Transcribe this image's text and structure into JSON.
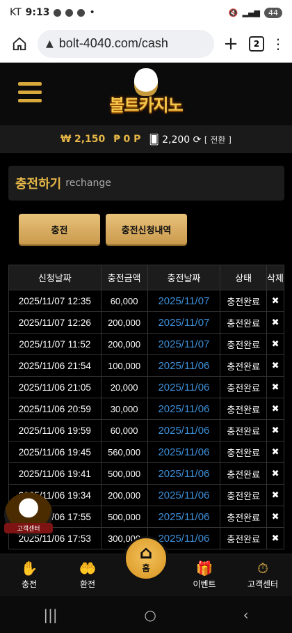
{
  "status_bar": {
    "carrier": "KT",
    "time": "9:13",
    "dot": "•",
    "battery": "44"
  },
  "browser": {
    "url": "bolt-4040.com/cash",
    "tab_count": "2"
  },
  "header": {
    "logo_text": "볼트카지노"
  },
  "balance": {
    "won_symbol": "₩",
    "won_value": "2,150",
    "point_symbol": "₱",
    "point_value": "0 P",
    "chip_value": "2,200",
    "convert_label": "[ 전환 ]"
  },
  "page": {
    "title_ko": "충전하기",
    "title_en": "rechange"
  },
  "buttons": {
    "charge": "충전",
    "history": "충전신청내역"
  },
  "table": {
    "headers": [
      "신청날짜",
      "충전금액",
      "충전날짜",
      "상태",
      "삭제"
    ],
    "rows": [
      {
        "req": "2025/11/07 12:35",
        "amt": "60,000",
        "date": "2025/11/07",
        "status": "충전완료",
        "del": "✖"
      },
      {
        "req": "2025/11/07 12:26",
        "amt": "200,000",
        "date": "2025/11/07",
        "status": "충전완료",
        "del": "✖"
      },
      {
        "req": "2025/11/07 11:52",
        "amt": "200,000",
        "date": "2025/11/07",
        "status": "충전완료",
        "del": "✖"
      },
      {
        "req": "2025/11/06 21:54",
        "amt": "100,000",
        "date": "2025/11/06",
        "status": "충전완료",
        "del": "✖"
      },
      {
        "req": "2025/11/06 21:05",
        "amt": "20,000",
        "date": "2025/11/06",
        "status": "충전완료",
        "del": "✖"
      },
      {
        "req": "2025/11/06 20:59",
        "amt": "30,000",
        "date": "2025/11/06",
        "status": "충전완료",
        "del": "✖"
      },
      {
        "req": "2025/11/06 19:59",
        "amt": "60,000",
        "date": "2025/11/06",
        "status": "충전완료",
        "del": "✖"
      },
      {
        "req": "2025/11/06 19:45",
        "amt": "560,000",
        "date": "2025/11/06",
        "status": "충전완료",
        "del": "✖"
      },
      {
        "req": "2025/11/06 19:41",
        "amt": "500,000",
        "date": "2025/11/06",
        "status": "충전완료",
        "del": "✖"
      },
      {
        "req": "2025/11/06 19:34",
        "amt": "200,000",
        "date": "2025/11/06",
        "status": "충전완료",
        "del": "✖"
      },
      {
        "req": "2025/11/06 17:55",
        "amt": "500,000",
        "date": "2025/11/06",
        "status": "충전완료",
        "del": "✖"
      },
      {
        "req": "2025/11/06 17:53",
        "amt": "300,000",
        "date": "2025/11/06",
        "status": "충전완료",
        "del": "✖"
      }
    ]
  },
  "cs_badge": {
    "label": "고객센터"
  },
  "bottom_nav": {
    "items": [
      {
        "label": "충전",
        "icon": "hand-coin-icon"
      },
      {
        "label": "환전",
        "icon": "hands-exchange-icon"
      },
      {
        "label": "홈",
        "icon": "home-icon"
      },
      {
        "label": "이벤트",
        "icon": "gift-icon"
      },
      {
        "label": "고객센터",
        "icon": "support-24-icon"
      }
    ]
  }
}
